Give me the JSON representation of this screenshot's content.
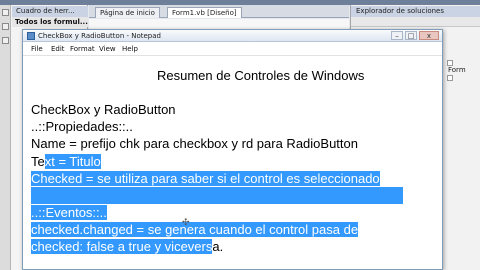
{
  "ide": {
    "toolbox_title": "Cuadro de herr...",
    "toolbox_group": "Todos los formul...",
    "tabs": [
      {
        "label": "Página de inicio"
      },
      {
        "label": "Form1.vb [Diseño]"
      }
    ],
    "solution_title": "Explorador de soluciones",
    "solution_item": "Form"
  },
  "notepad": {
    "title": "CheckBox y RadioButton - Notepad",
    "menu": [
      "File",
      "Edit",
      "Format",
      "View",
      "Help"
    ],
    "controls": {
      "minimize": "–",
      "maximize": "□",
      "close": "x"
    }
  },
  "document": {
    "heading": "Resumen de Controles de Windows",
    "subheading": "CheckBox y RadioButton",
    "properties_label": "..::Propiedades::..",
    "name_line": "Name = prefijo chk para checkbox y rd para RadioButton",
    "text_line_plain": "Te",
    "text_line_selected": "xt = Titulo",
    "checked_line": "Checked = se utiliza para saber si el control es seleccionado",
    "events_label": "..::Eventos::..",
    "changed_line_1": "checked.changed = se genera cuando el control pasa de",
    "changed_line_2_selected": "checked: false a true y vicevers",
    "changed_line_2_plain": "a."
  },
  "colors": {
    "selection": "#3399ff",
    "selection_text": "#ffffff"
  }
}
